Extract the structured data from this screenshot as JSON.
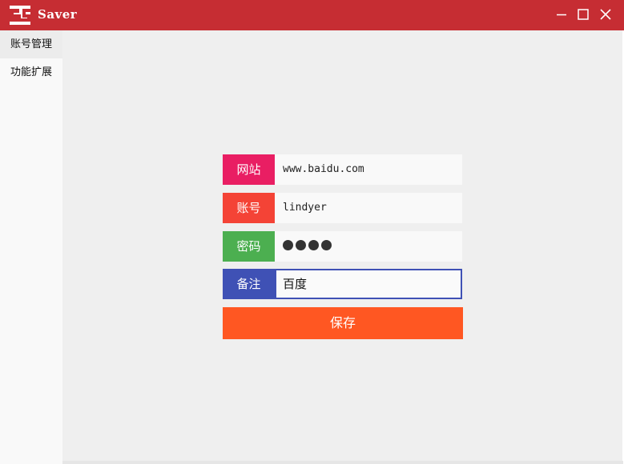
{
  "window": {
    "title": "Saver",
    "controls": [
      "minimize-icon",
      "maximize-icon",
      "close-icon"
    ],
    "titlebar_color": "#c62d33"
  },
  "sidebar": {
    "items": [
      {
        "label": "账号管理",
        "active": true
      },
      {
        "label": "功能扩展",
        "active": false
      }
    ]
  },
  "form": {
    "fields": [
      {
        "label": "网站",
        "value": "www.baidu.com",
        "label_color": "#e91e63"
      },
      {
        "label": "账号",
        "value": "lindyer",
        "label_color": "#f44336"
      },
      {
        "label": "密码",
        "value": "●●●●",
        "masked": true,
        "label_color": "#4caf50"
      },
      {
        "label": "备注",
        "value": "百度",
        "label_color": "#3f51b5",
        "focused": true
      }
    ],
    "save_label": "保存",
    "save_color": "#ff5722"
  }
}
